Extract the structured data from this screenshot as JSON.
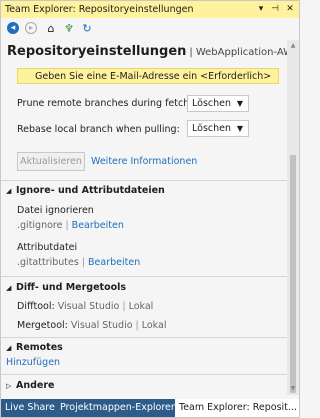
{
  "window": {
    "title": "Team Explorer: Repositoryeinstellungen"
  },
  "page": {
    "title": "Repositoryeinstellungen",
    "separator": "|",
    "repo": "WebApplication-AWS"
  },
  "warning": {
    "text": "Geben Sie eine E-Mail-Adresse ein <Erforderlich>"
  },
  "settings": {
    "prune": {
      "label": "Prune remote branches during fetch:",
      "value": "Löschen"
    },
    "rebase": {
      "label": "Rebase local branch when pulling:",
      "value": "Löschen"
    },
    "update_button": "Aktualisieren",
    "more_info": "Weitere Informationen"
  },
  "ignore": {
    "header": "Ignore- und Attributdateien",
    "ignore_file": {
      "label": "Datei ignorieren",
      "path": ".gitignore",
      "sep": "|",
      "edit": "Bearbeiten"
    },
    "attr_file": {
      "label": "Attributdatei",
      "path": ".gitattributes",
      "sep": "|",
      "edit": "Bearbeiten"
    }
  },
  "diff": {
    "header": "Diff- und Mergetools",
    "difftool": {
      "label": "Difftool:",
      "opt1": "Visual Studio",
      "sep": "|",
      "opt2": "Lokal"
    },
    "mergetool": {
      "label": "Mergetool:",
      "opt1": "Visual Studio",
      "sep": "|",
      "opt2": "Lokal"
    }
  },
  "remotes": {
    "header": "Remotes",
    "add": "Hinzufügen"
  },
  "other": {
    "header": "Andere"
  },
  "tabs": [
    "Live Share",
    "Projektmappen-Explorer",
    "Team Explorer: Reposit..."
  ],
  "colors": {
    "title_bar": "#fff29d",
    "tab_bar": "#2d5b8a",
    "link": "#1e6fbd",
    "back": "#1e6fbd"
  }
}
